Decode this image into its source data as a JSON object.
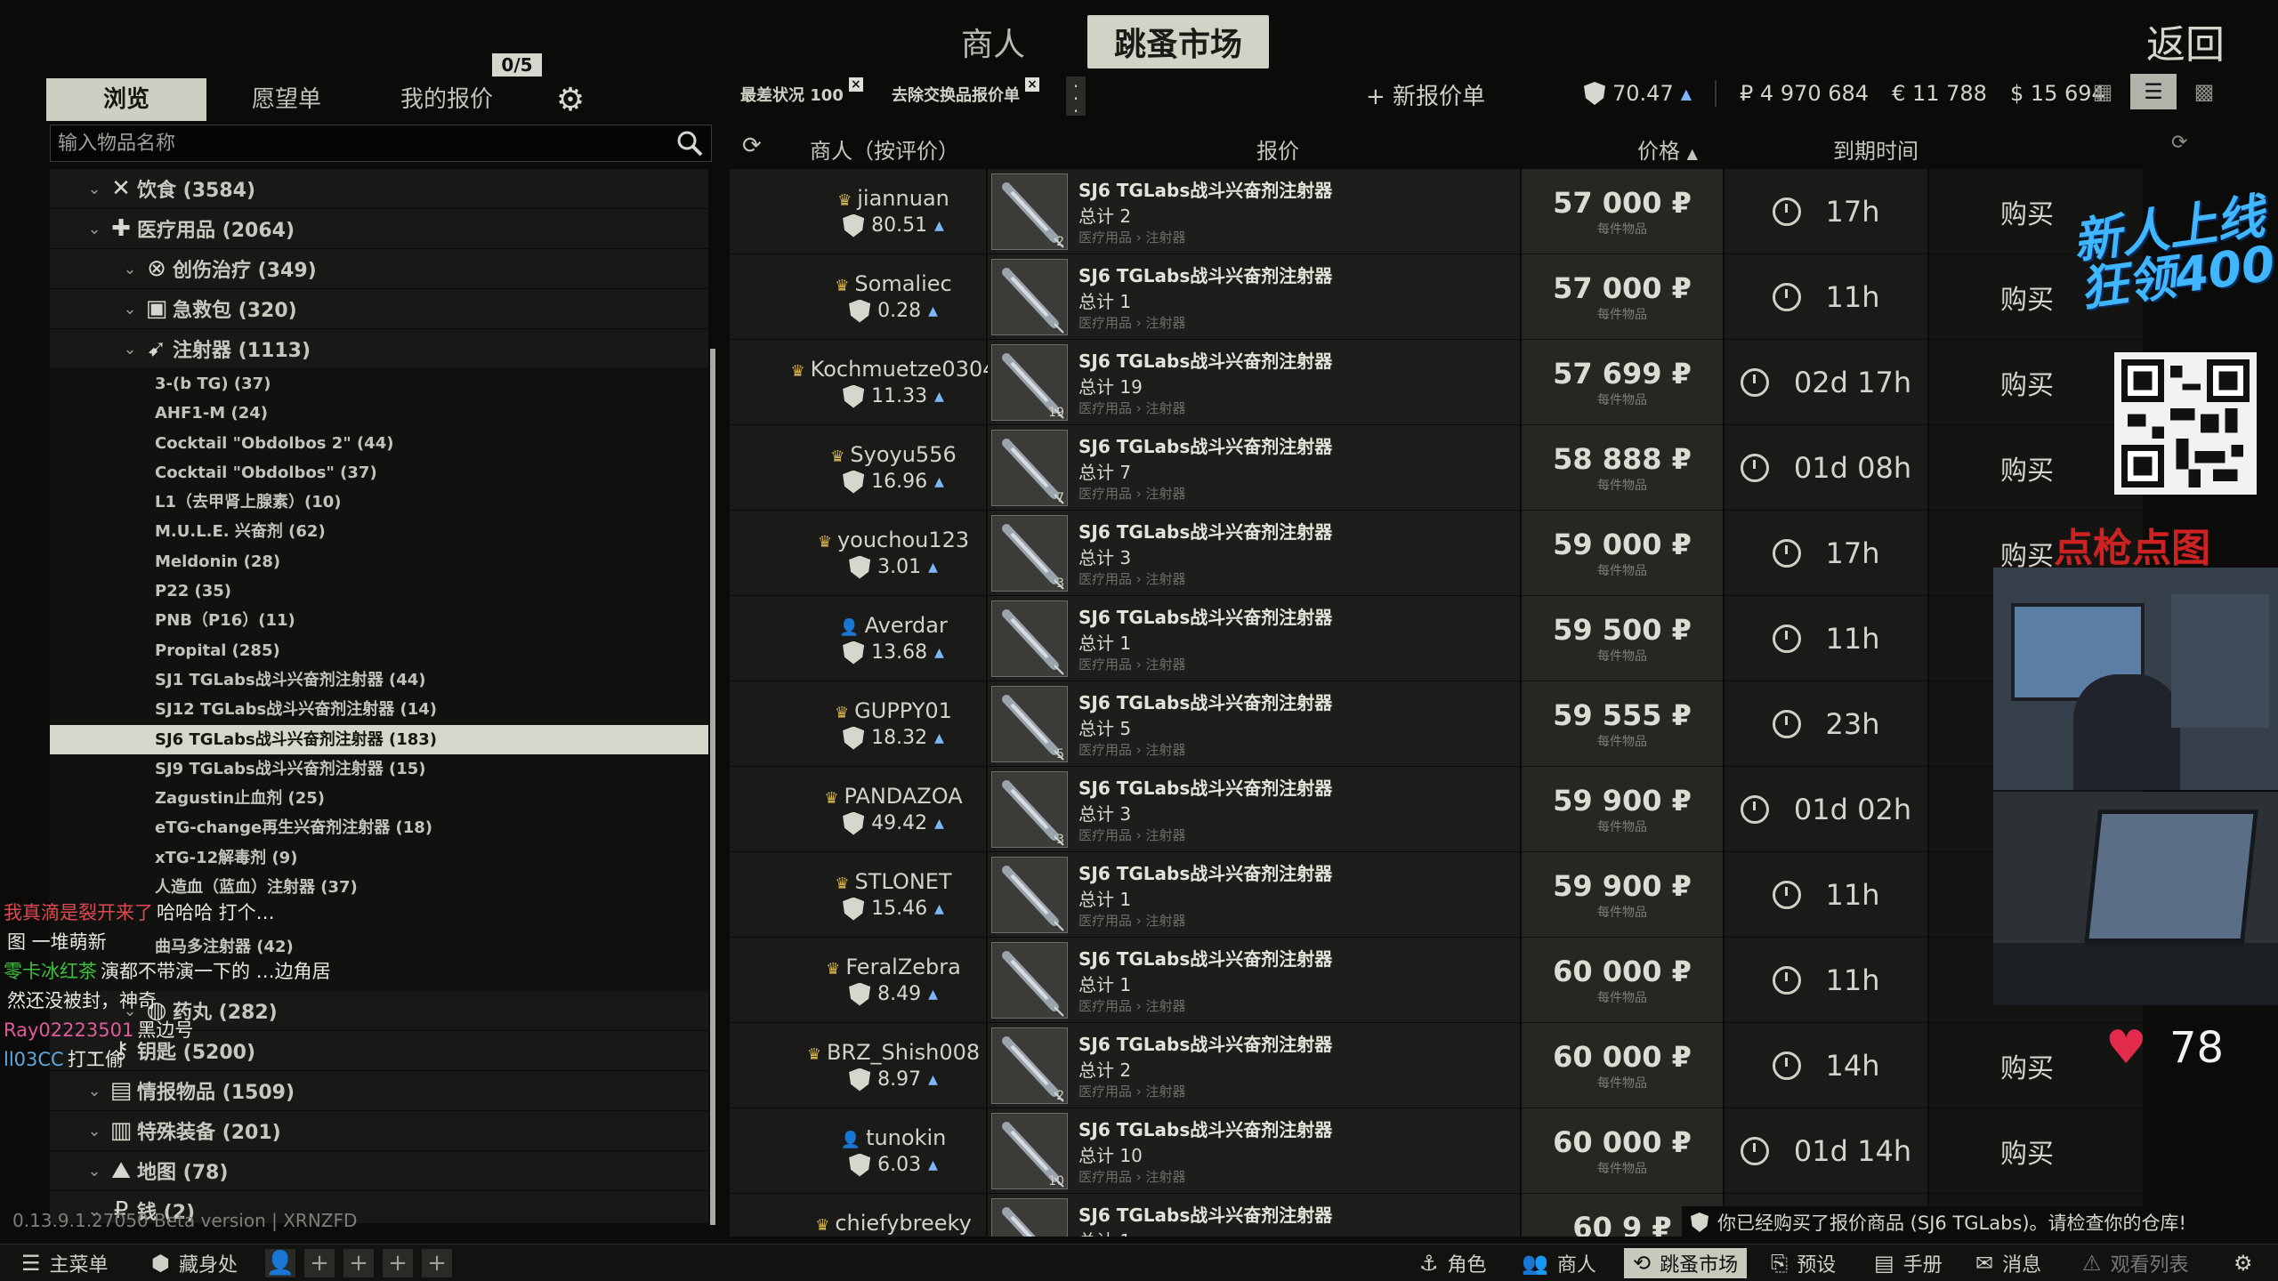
{
  "top_tabs": [
    "商人",
    "跳蚤市场"
  ],
  "active_top_tab": "跳蚤市场",
  "back_label": "返回",
  "left_tabs": [
    "浏览",
    "愿望单",
    "我的报价"
  ],
  "offer_count": "0/5",
  "search": {
    "placeholder": "输入物品名称"
  },
  "tree": {
    "cats_top": [
      {
        "label": "饮食 (3584)",
        "icon": "utensils-icon",
        "level": 0
      },
      {
        "label": "医疗用品 (2064)",
        "icon": "medical-cross-icon",
        "level": 0
      },
      {
        "label": "创伤治疗 (349)",
        "icon": "injury-treatment-icon",
        "level": 1
      },
      {
        "label": "急救包 (320)",
        "icon": "medkit-icon",
        "level": 1
      },
      {
        "label": "注射器 (1113)",
        "icon": "syringe-icon",
        "level": 1
      }
    ],
    "leaves": [
      "3-(b TG) (37)",
      "AHF1-M (24)",
      "Cocktail \"Obdolbos 2\" (44)",
      "Cocktail \"Obdolbos\" (37)",
      "L1（去甲肾上腺素）(10)",
      "M.U.L.E. 兴奋剂 (62)",
      "Meldonin (28)",
      "P22 (35)",
      "PNB（P16）(11)",
      "Propital (285)",
      "SJ1 TGLabs战斗兴奋剂注射器 (44)",
      "SJ12 TGLabs战斗兴奋剂注射器 (14)",
      "SJ6 TGLabs战斗兴奋剂注射器 (183)",
      "SJ9 TGLabs战斗兴奋剂注射器 (15)",
      "Zagustin止血剂 (25)",
      "eTG-change再生兴奋剂注射器 (18)",
      "xTG-12解毒剂 (9)",
      "人造血（蓝血）注射器 (37)",
      "",
      "曲马多注射器 (42)",
      ""
    ],
    "selected_leaf": "SJ6 TGLabs战斗兴奋剂注射器 (183)",
    "cats_bottom": [
      {
        "label": "药丸 (282)",
        "icon": "pills-icon",
        "level": 1
      },
      {
        "label": "钥匙 (5200)",
        "icon": "key-icon",
        "level": 0
      },
      {
        "label": "情报物品 (1509)",
        "icon": "intel-folder-icon",
        "level": 0
      },
      {
        "label": "特殊装备 (201)",
        "icon": "special-equipment-icon",
        "level": 0
      },
      {
        "label": "地图 (78)",
        "icon": "map-icon",
        "level": 0
      },
      {
        "label": "钱 (2)",
        "icon": "ruble-icon",
        "level": 0
      }
    ]
  },
  "filters": {
    "chip1": "最差状况 100",
    "chip2": "去除交换品报价单"
  },
  "new_offer_label": "+ 新报价单",
  "balances": {
    "rating": "70.47",
    "rub": "₽ 4 970 684",
    "eur": "€ 11 788",
    "usd": "$ 15 694"
  },
  "columns": {
    "trader": "商人（按评价）",
    "offer": "报价",
    "price": "价格",
    "expiry": "到期时间"
  },
  "offers": [
    {
      "trader": "jiannuan",
      "crown": true,
      "rating": "80.51",
      "name": "SJ6 TGLabs战斗兴奋剂注射器",
      "total": "总计 2",
      "qty": "2",
      "price": "57 000",
      "expiry": "17h",
      "buy": "购买"
    },
    {
      "trader": "Somaliec",
      "crown": true,
      "rating": "0.28",
      "name": "SJ6 TGLabs战斗兴奋剂注射器",
      "total": "总计 1",
      "qty": "",
      "price": "57 000",
      "expiry": "11h",
      "buy": "购买"
    },
    {
      "trader": "Kochmuetze0304",
      "crown": true,
      "rating": "11.33",
      "name": "SJ6 TGLabs战斗兴奋剂注射器",
      "total": "总计 19",
      "qty": "19",
      "price": "57 699",
      "expiry": "02d 17h",
      "buy": "购买"
    },
    {
      "trader": "Syoyu556",
      "crown": true,
      "rating": "16.96",
      "name": "SJ6 TGLabs战斗兴奋剂注射器",
      "total": "总计 7",
      "qty": "7",
      "price": "58 888",
      "expiry": "01d 08h",
      "buy": "购买"
    },
    {
      "trader": "youchou123",
      "crown": true,
      "rating": "3.01",
      "name": "SJ6 TGLabs战斗兴奋剂注射器",
      "total": "总计 3",
      "qty": "3",
      "price": "59 000",
      "expiry": "17h",
      "buy": "购买"
    },
    {
      "trader": "Averdar",
      "crown": false,
      "rating": "13.68",
      "name": "SJ6 TGLabs战斗兴奋剂注射器",
      "total": "总计 1",
      "qty": "",
      "price": "59 500",
      "expiry": "11h",
      "buy": "购买"
    },
    {
      "trader": "GUPPY01",
      "crown": true,
      "rating": "18.32",
      "name": "SJ6 TGLabs战斗兴奋剂注射器",
      "total": "总计 5",
      "qty": "5",
      "price": "59 555",
      "expiry": "23h",
      "buy": "购买"
    },
    {
      "trader": "PANDAZOA",
      "crown": true,
      "rating": "49.42",
      "name": "SJ6 TGLabs战斗兴奋剂注射器",
      "total": "总计 3",
      "qty": "3",
      "price": "59 900",
      "expiry": "01d 02h",
      "buy": "购买"
    },
    {
      "trader": "STLONET",
      "crown": true,
      "rating": "15.46",
      "name": "SJ6 TGLabs战斗兴奋剂注射器",
      "total": "总计 1",
      "qty": "",
      "price": "59 900",
      "expiry": "11h",
      "buy": "购买"
    },
    {
      "trader": "FeralZebra",
      "crown": true,
      "rating": "8.49",
      "name": "SJ6 TGLabs战斗兴奋剂注射器",
      "total": "总计 1",
      "qty": "",
      "price": "60 000",
      "expiry": "11h",
      "buy": "购买"
    },
    {
      "trader": "BRZ_Shish008",
      "crown": true,
      "rating": "8.97",
      "name": "SJ6 TGLabs战斗兴奋剂注射器",
      "total": "总计 2",
      "qty": "2",
      "price": "60 000",
      "expiry": "14h",
      "buy": "购买"
    },
    {
      "trader": "tunokin",
      "crown": false,
      "rating": "6.03",
      "name": "SJ6 TGLabs战斗兴奋剂注射器",
      "total": "总计 10",
      "qty": "10",
      "price": "60 000",
      "expiry": "01d 14h",
      "buy": "购买"
    },
    {
      "trader": "chiefybreeky",
      "crown": true,
      "rating": "",
      "name": "SJ6 TGLabs战斗兴奋剂注射器",
      "total": "总计 1",
      "qty": "",
      "price": "60 9",
      "expiry": "",
      "buy": ""
    }
  ],
  "item_category": "医疗用品 › 注射器",
  "price_sub": "每件物品",
  "overlay": {
    "promo": "新人上线 狂领400",
    "red_text": "点枪点图",
    "heart_rate": "78"
  },
  "chat": [
    {
      "user": "我真滴是裂开来了",
      "user_color": "#e0494f",
      "msg": "哈哈哈 打个…"
    },
    {
      "user": "",
      "user_color": "#e0494f",
      "msg": "图 一堆萌新"
    },
    {
      "user": "零卡冰红茶",
      "user_color": "#3fbf3f",
      "msg": "演都不带演一下的 …边角居"
    },
    {
      "user": "",
      "user_color": "#e0494f",
      "msg": "然还没被封，神奇"
    },
    {
      "user": "Ray02223501",
      "user_color": "#e35a9b",
      "msg": "黑边号"
    },
    {
      "user": "ll03CC",
      "user_color": "#5fa8e0",
      "msg": "打工偷"
    }
  ],
  "version": "0.13.9.1.27050 Beta version | XRNZFD",
  "notification": "你已经购买了报价商品 (SJ6 TGLabs)。请检查你的仓库!",
  "bottom_bar": {
    "main_menu": "主菜单",
    "stash": "藏身处",
    "character": "角色",
    "traders": "商人",
    "flea": "跳蚤市场",
    "presets": "预设",
    "handbook": "手册",
    "messages": "消息",
    "watchlist": "观看列表"
  }
}
